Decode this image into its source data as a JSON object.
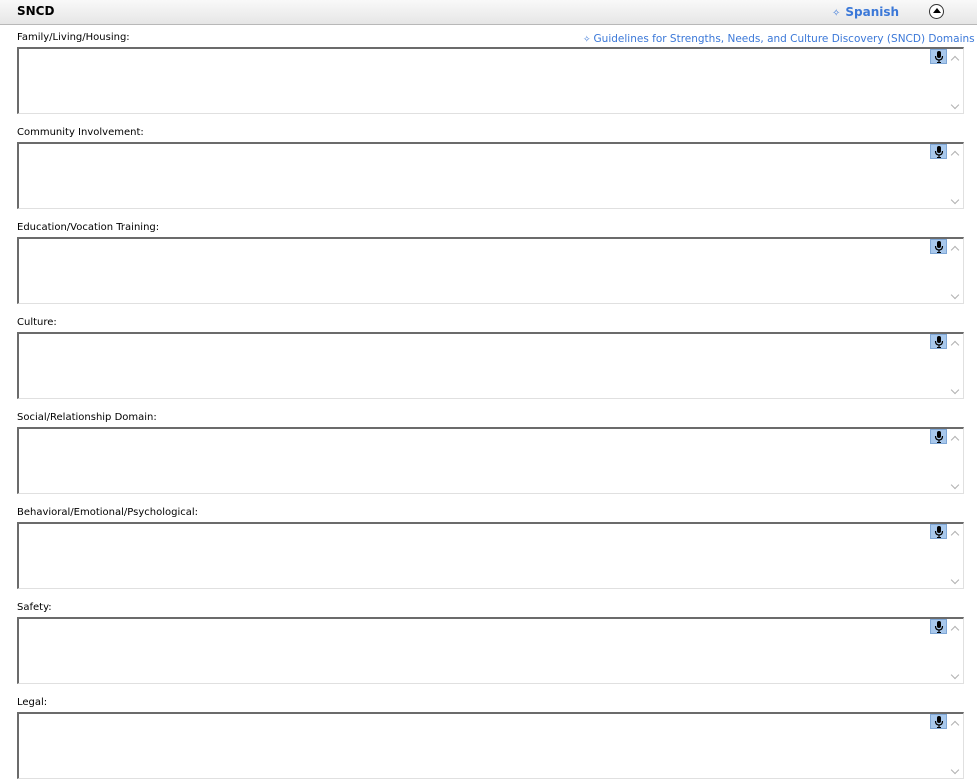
{
  "header": {
    "title": "SNCD",
    "language_link": "Spanish",
    "collapse_icon": "chevron-up-circle-icon"
  },
  "guidelines_link": "Guidelines for Strengths, Needs, and Culture Discovery (SNCD) Domains",
  "fields": [
    {
      "label": "Family/Living/Housing:",
      "value": ""
    },
    {
      "label": "Community Involvement:",
      "value": ""
    },
    {
      "label": "Education/Vocation Training:",
      "value": ""
    },
    {
      "label": "Culture:",
      "value": ""
    },
    {
      "label": "Social/Relationship Domain:",
      "value": ""
    },
    {
      "label": "Behavioral/Emotional/Psychological:",
      "value": ""
    },
    {
      "label": "Safety:",
      "value": ""
    },
    {
      "label": "Legal:",
      "value": ""
    }
  ],
  "colors": {
    "link": "#3b78d8",
    "mic_button": "#a8c8ec"
  },
  "icons": {
    "mic": "microphone-icon",
    "bullet": "four-point-star-icon"
  }
}
